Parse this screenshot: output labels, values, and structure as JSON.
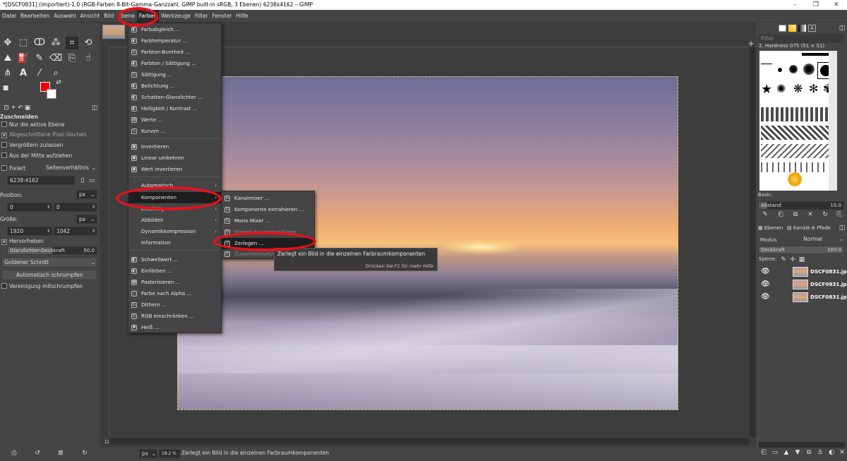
{
  "window": {
    "title": "*[DSCF0831] (importiert)-1.0 (RGB-Farben 8-Bit-Gamma-Ganzzahl, GIMP built-in sRGB, 3 Ebenen) 6238x4162 – GIMP",
    "minimize": "–",
    "maximize": "❐",
    "close": "✕"
  },
  "menubar": [
    "Datei",
    "Bearbeiten",
    "Auswahl",
    "Ansicht",
    "Bild",
    "Ebene",
    "Farben",
    "Werkzeuge",
    "Filter",
    "Fenster",
    "Hilfe"
  ],
  "menubar_active_index": 6,
  "tool_options": {
    "title": "Zuschneiden",
    "current_layer_only": "Nur die aktive Ebene",
    "delete_cropped": "Abgeschnittene Pixel löschen",
    "allow_growing": "Vergrößern zulassen",
    "expand_from_center": "Aus der Mitte aufziehen",
    "fixed_label": "Fixiert",
    "fixed_mode": "Seitenverhältnis",
    "ratio_value": "6238:4162",
    "position_label": "Position:",
    "position_unit": "px",
    "position_x": "0",
    "position_y": "0",
    "size_label": "Größe:",
    "size_unit": "px",
    "size_w": "1920",
    "size_h": "1042",
    "highlight": "Hervorheben",
    "highlight_opacity_label": "Glanzlichter-Deckkraft",
    "highlight_opacity_value": "50.0",
    "highlight_opacity_fraction": 0.5,
    "guides": "Goldener Schnitt",
    "auto_shrink": "Automatisch schrumpfen",
    "shrink_merged": "Vereinigung mitschrumpfen"
  },
  "farben_menu": {
    "items": [
      "Farbabgleich ...",
      "Farbtemperatur ...",
      "Farbton-Buntheit ...",
      "Farbton / Sättigung ...",
      "Sättigung ...",
      "Belichtung ...",
      "Schatten-Glanzlichter ...",
      "Helligkeit / Kontrast ...",
      "Werte ...",
      "Kurven ...",
      "Invertieren",
      "Linear umkehren",
      "Wert invertieren",
      "Automatisch",
      "Komponenten",
      "Entsättigen",
      "Abbilden",
      "Dynamikkompression",
      "Information",
      "Schwellwert ...",
      "Einfärben ...",
      "Posterisieren ...",
      "Farbe nach Alpha ...",
      "Dithern ...",
      "RGB einschränken ...",
      "Heiß ..."
    ]
  },
  "komponenten_menu": {
    "items": [
      "Kanalmixer ...",
      "Komponente extrahieren ...",
      "Mono Mixer ...",
      "Wieder zusammenfügen",
      "Zerlegen ...",
      "Zusammensetzen ..."
    ]
  },
  "tooltip": {
    "text": "Zerlegt ein Bild in die einzelnen Farbraumkomponenten",
    "hint": "Drücken Sie F1 für mehr Hilfe"
  },
  "statusbar": {
    "unit": "px",
    "zoom": "18.2 %",
    "message": "Zerlegt ein Bild in die einzelnen Farbraumkomponenten"
  },
  "brushes": {
    "filter_placeholder": "Filter",
    "current": "2. Hardness 075 (51 × 51)",
    "tag": "Basic.",
    "spacing_label": "Abstand",
    "spacing_value": "10.0",
    "spacing_fraction": 0.1
  },
  "layers": {
    "tabs": [
      "Ebenen",
      "Kanäle",
      "Pfade"
    ],
    "mode_label": "Modus",
    "mode_value": "Normal",
    "opacity_label": "Deckkraft",
    "opacity_value": "100.0",
    "opacity_fraction": 1.0,
    "lock_label": "Sperre:",
    "items": [
      "DSCF0831.jp",
      "DSCF0831.jp",
      "DSCF0831.jp"
    ]
  },
  "colors": {
    "annotation_ring": "#e8101a",
    "foreground": "#ee0000",
    "background": "#ffffff"
  }
}
